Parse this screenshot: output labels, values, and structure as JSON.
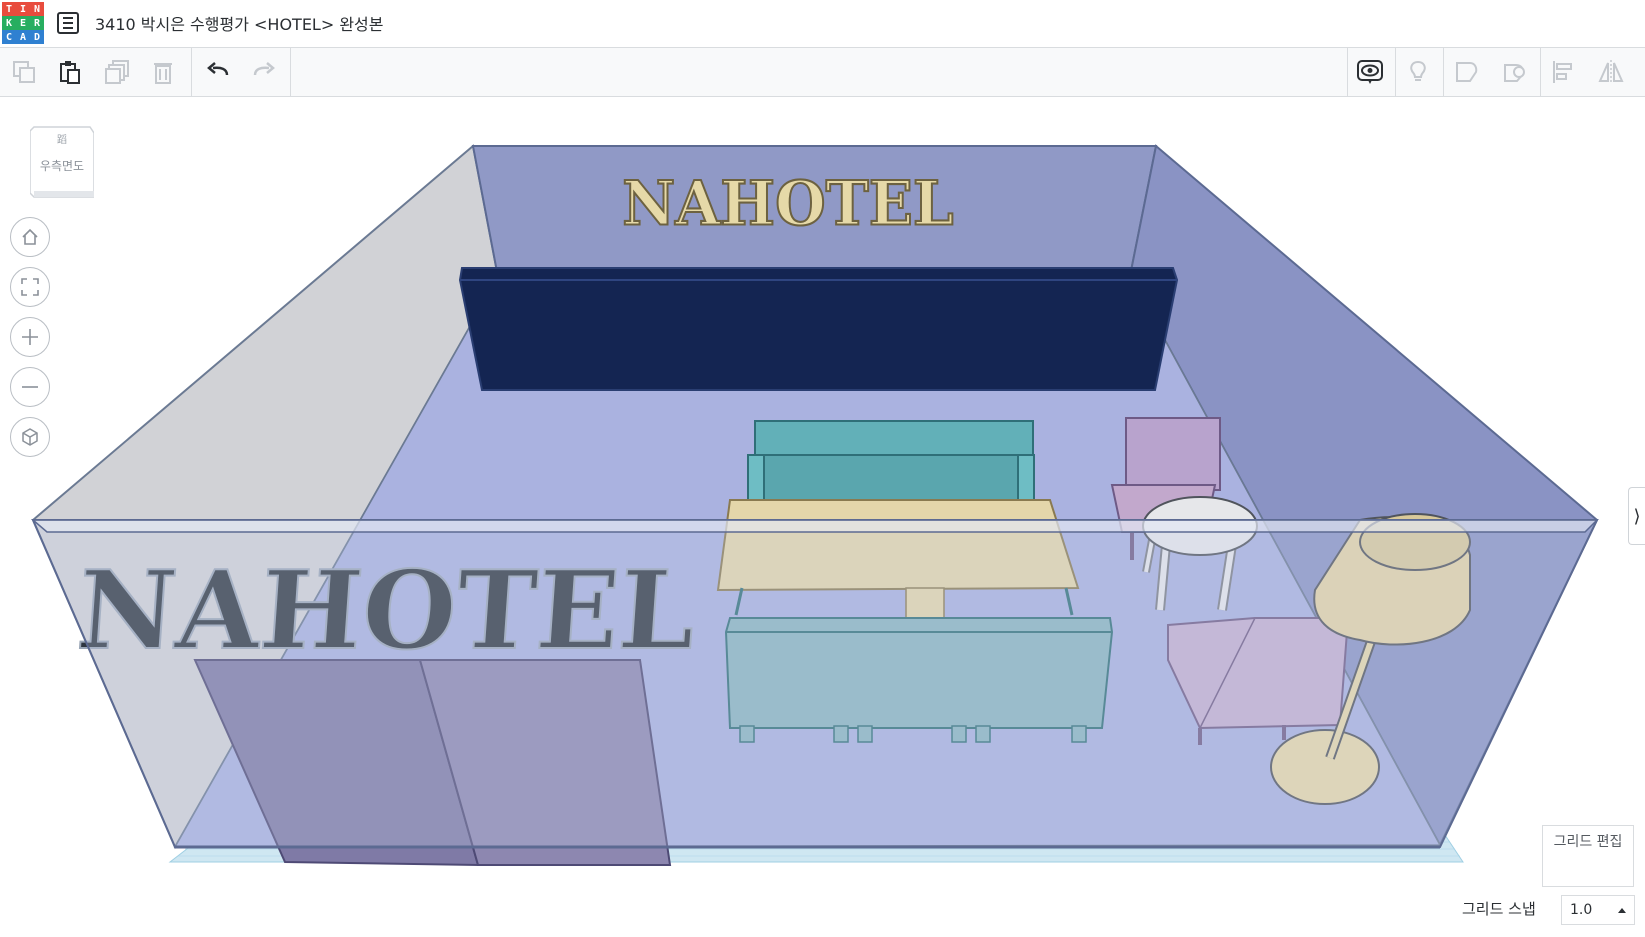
{
  "logo": {
    "letters": [
      "T",
      "I",
      "N",
      "K",
      "E",
      "R",
      "C",
      "A",
      "D"
    ],
    "colors": [
      "#e84c3d",
      "#e84c3d",
      "#e84c3d",
      "#27ae60",
      "#27ae60",
      "#27ae60",
      "#2f80d1",
      "#2f80d1",
      "#2f80d1"
    ]
  },
  "header": {
    "title": "3410 박시은 수행평가 <HOTEL> 완성본"
  },
  "toolbar": {
    "left_icons": [
      "copy-icon",
      "paste-icon",
      "duplicate-icon",
      "delete-icon",
      "undo-icon",
      "redo-icon"
    ],
    "right_icons": [
      "visibility-icon",
      "light-bulb-icon",
      "shape-solid-icon",
      "shape-hole-icon",
      "align-icon",
      "mirror-icon"
    ]
  },
  "viewcube": {
    "face_label": "우측면도"
  },
  "nav": {
    "icons": [
      "home-icon",
      "fit-view-icon",
      "zoom-in-icon",
      "zoom-out-icon",
      "perspective-icon"
    ]
  },
  "scene": {
    "wall_sign_text": "NAHOTEL",
    "front_sign_text": "NAHOTEL"
  },
  "grid": {
    "edit_label": "그리드 편집",
    "snap_label": "그리드 스냅",
    "snap_value": "1.0"
  },
  "colors": {
    "accent": "#2f80d1",
    "wall_back": "#9099c6",
    "floor": "#aab2e0",
    "cabinet": "#142552",
    "sofa": "#62b0b8",
    "chair": "#c2a8cc",
    "table": "#e4d6aa",
    "lamp": "#e3d3a6"
  }
}
